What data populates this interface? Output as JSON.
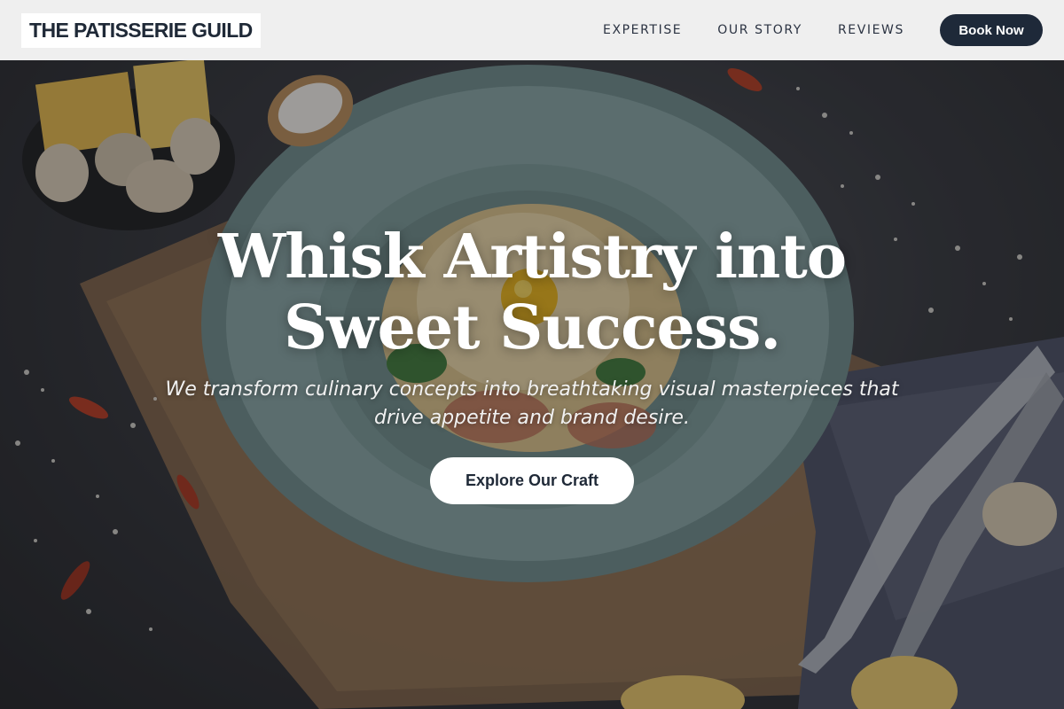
{
  "brand": {
    "name": "THE PATISSERIE GUILD"
  },
  "nav": {
    "links": [
      "EXPERTISE",
      "OUR STORY",
      "REVIEWS"
    ],
    "cta": "Book Now"
  },
  "hero": {
    "title": "Whisk Artistry into Sweet Success.",
    "subtitle": "We transform culinary concepts into breathtaking visual masterpieces that drive appetite and brand desire.",
    "cta": "Explore Our Craft",
    "image": "plated pasta dish on teal ceramic bowl"
  },
  "colors": {
    "nav_bg": "#f6f6f6",
    "brand_text": "#1f2937",
    "button_dark": "#1e2939",
    "hero_text": "#ffffff"
  }
}
